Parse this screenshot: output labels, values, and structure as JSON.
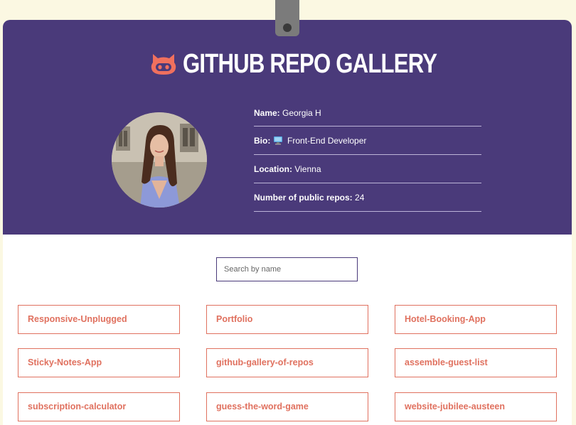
{
  "header": {
    "title": "GITHUB REPO GALLERY",
    "logo_icon": "github-octocat-icon",
    "accent_color": "#4a3a7a",
    "logo_color": "#f0705e"
  },
  "profile": {
    "name_label": "Name:",
    "name_value": "Georgia H",
    "bio_label": "Bio:",
    "bio_icon": "computer-icon",
    "bio_value": "Front-End Developer",
    "location_label": "Location:",
    "location_value": "Vienna",
    "repos_label": "Number of public repos:",
    "repos_value": "24"
  },
  "search": {
    "placeholder": "Search by name"
  },
  "repos": [
    "Responsive-Unplugged",
    "Portfolio",
    "Hotel-Booking-App",
    "Sticky-Notes-App",
    "github-gallery-of-repos",
    "assemble-guest-list",
    "subscription-calculator",
    "guess-the-word-game",
    "website-jubilee-austeen"
  ],
  "colors": {
    "page_bg": "#fbf8e2",
    "repo_text": "#e0715f"
  }
}
